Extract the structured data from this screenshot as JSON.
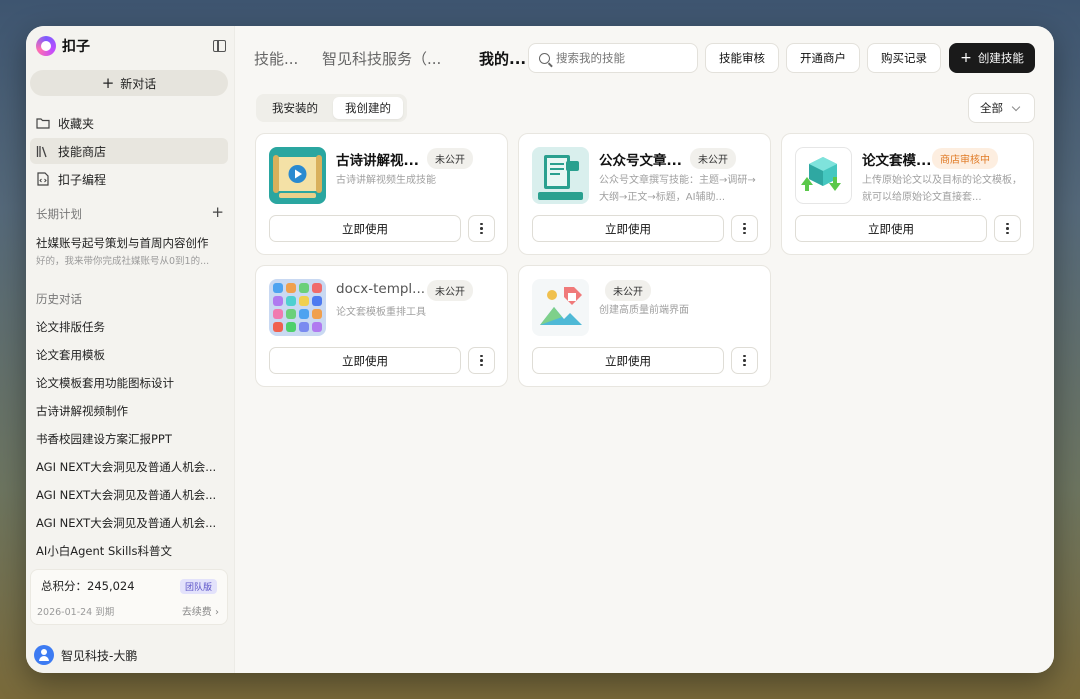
{
  "brand": {
    "name": "扣子"
  },
  "sidebar": {
    "new_chat": "新对话",
    "nav": [
      {
        "label": "收藏夹",
        "icon": "folder-icon"
      },
      {
        "label": "技能商店",
        "icon": "books-icon"
      },
      {
        "label": "扣子编程",
        "icon": "code-file-icon"
      }
    ],
    "long_plan_title": "长期计划",
    "plan": {
      "title": "社媒账号起号策划与首周内容创作",
      "subtitle": "好的，我来带你完成社媒账号从0到1的..."
    },
    "history_title": "历史对话",
    "history": [
      "论文排版任务",
      "论文套用模板",
      "论文模板套用功能图标设计",
      "古诗讲解视频制作",
      "书香校园建设方案汇报PPT",
      "AGI NEXT大会洞见及普通人机会...",
      "AGI NEXT大会洞见及普通人机会...",
      "AGI NEXT大会洞见及普通人机会...",
      "AI小白Agent Skills科普文"
    ],
    "points": {
      "label": "总积分：245,024",
      "badge": "团队版",
      "expire": "2026-01-24 到期",
      "renew": "去续费 ›"
    },
    "user": "智见科技-大鹏"
  },
  "header": {
    "tabs": [
      "技能...",
      "智见科技服务（...",
      "我的..."
    ],
    "search_placeholder": "搜索我的技能",
    "buttons": [
      "技能审核",
      "开通商户",
      "购买记录"
    ],
    "create": "创建技能"
  },
  "filters": {
    "segments": [
      "我安装的",
      "我创建的"
    ],
    "select": "全部"
  },
  "cards": [
    {
      "title": "古诗讲解视...",
      "badge": "未公开",
      "desc": "古诗讲解视频生成技能",
      "use": "立即使用",
      "thumb": "scroll-video-icon"
    },
    {
      "title": "公众号文章...",
      "badge": "未公开",
      "desc": "公众号文章撰写技能：主题→调研→大纲→正文→标题，AI辅助...",
      "use": "立即使用",
      "thumb": "article-book-icon"
    },
    {
      "title": "论文套模...",
      "badge": "商店审核中",
      "desc": "上传原始论文以及目标的论文模板，就可以给原始论文直接套...",
      "use": "立即使用",
      "thumb": "cube-arrows-icon"
    },
    {
      "title": "docx-templ...",
      "badge": "未公开",
      "desc": "论文套模板重排工具",
      "use": "立即使用",
      "thumb": "app-grid-icon"
    },
    {
      "title": "",
      "badge": "未公开",
      "desc": "创建高质量前端界面",
      "use": "立即使用",
      "thumb": "frontend-logo-icon"
    }
  ],
  "colors": {
    "accent_dark": "#1a1a1a",
    "badge_orange": "#e07a25",
    "team_badge": "#5a52c7"
  }
}
